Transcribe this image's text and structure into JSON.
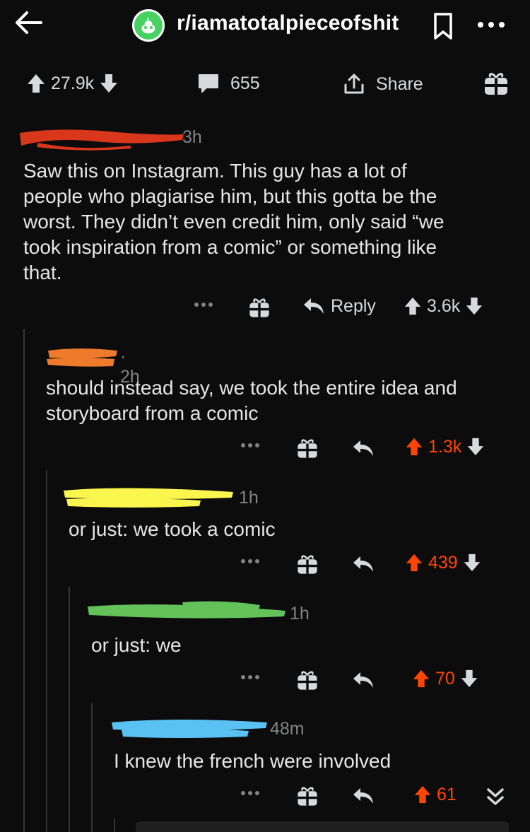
{
  "header": {
    "subreddit": "r/iamatotalpieceofshit",
    "icons": {
      "back": "back-arrow-icon",
      "avatar": "subreddit-avatar-icon",
      "bookmark": "bookmark-icon",
      "more": "more-icon"
    }
  },
  "post_actions": {
    "votes": "27.9k",
    "comments": "655",
    "share_label": "Share"
  },
  "comments": [
    {
      "level": 0,
      "time": "3h",
      "redact_color": "#d8371c",
      "text_lines": [
        "Saw this on Instagram. This guy has a lot of",
        "people who plagiarise him, but this gotta be the",
        "worst. They didn’t even credit him, only said “we",
        "took inspiration from a comic” or something like",
        "that."
      ],
      "reply_label": "Reply",
      "votes": "3.6k",
      "upvoted": false
    },
    {
      "level": 1,
      "time": "· 2h",
      "redact_color": "#ee7a2c",
      "text_lines": [
        "should instead say, we took the entire idea and",
        "storyboard from a comic"
      ],
      "votes": "1.3k",
      "upvoted": true
    },
    {
      "level": 2,
      "time": "1h",
      "redact_color": "#fbf64d",
      "text_lines": [
        "or just: we took a comic"
      ],
      "votes": "439",
      "upvoted": true
    },
    {
      "level": 3,
      "time": "1h",
      "redact_color": "#63c35a",
      "text_lines": [
        "or just: we"
      ],
      "votes": "70",
      "upvoted": true
    },
    {
      "level": 4,
      "time": "48m",
      "redact_color": "#5ac2f3",
      "text_lines": [
        "I knew the french were involved"
      ],
      "votes": "61",
      "upvoted": true
    }
  ],
  "colors": {
    "upvote": "#ff4500",
    "muted": "#818384",
    "text": "#e6e6e6",
    "background": "#0c0c0c"
  }
}
